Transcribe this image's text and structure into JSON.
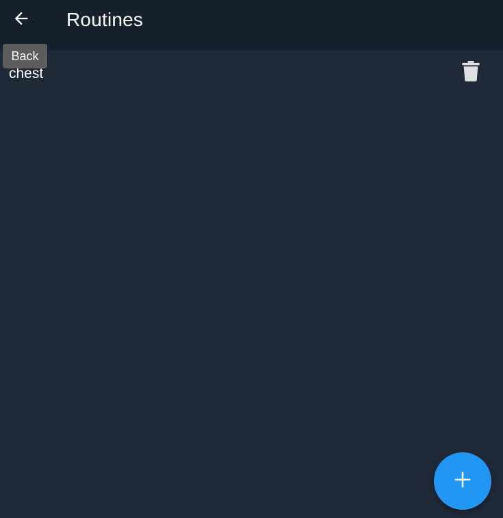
{
  "app_bar": {
    "title": "Routines",
    "back_icon": "arrow-left-icon"
  },
  "tooltip": {
    "text": "Back"
  },
  "routines": [
    {
      "label": "chest",
      "delete_icon": "trash-icon"
    }
  ],
  "fab": {
    "icon": "plus-icon"
  },
  "colors": {
    "background": "#202938",
    "app_bar": "#18202d",
    "accent": "#2196f3",
    "tooltip": "#5f5f5f",
    "text": "#ffffff",
    "icon_muted": "#e0e0e0"
  }
}
